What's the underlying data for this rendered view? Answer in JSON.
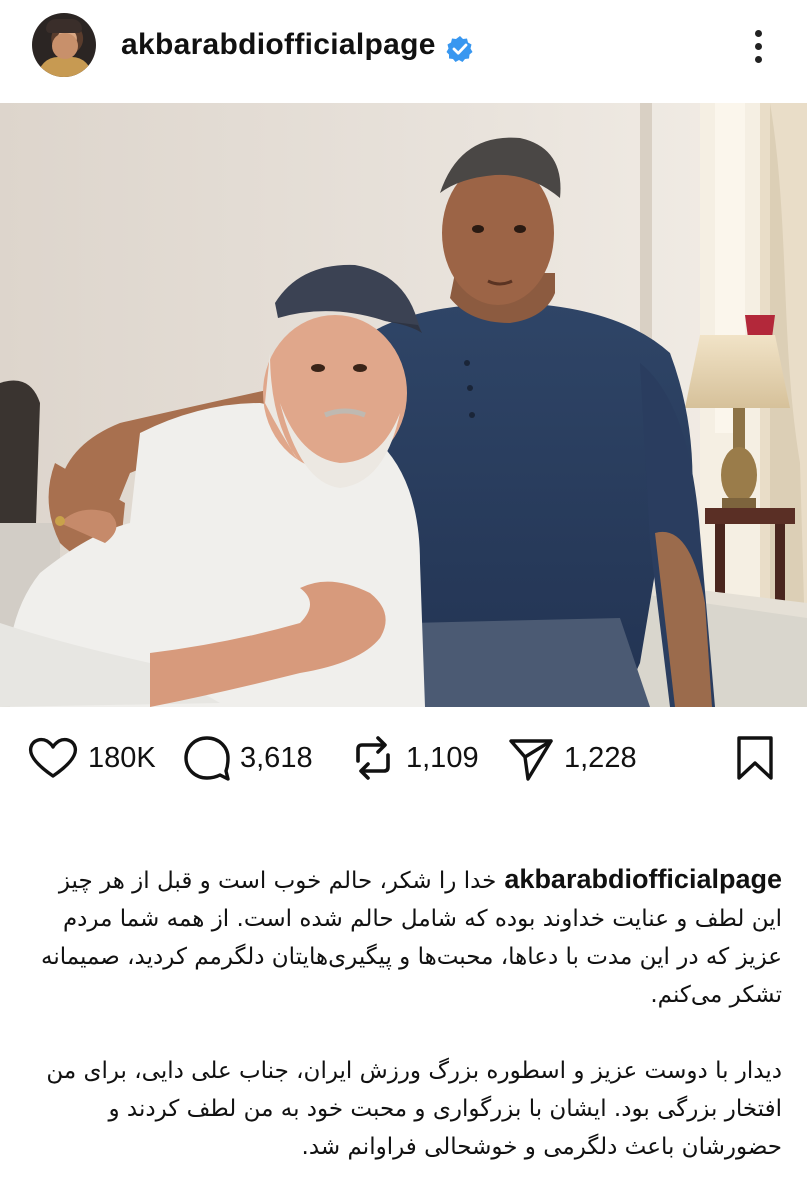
{
  "header": {
    "username": "akbarabdiofficialpage",
    "verified_icon": "verified-badge-icon",
    "more_icon": "more-vertical-icon",
    "accent": "#3897f0"
  },
  "post": {
    "photo_alt": "photo",
    "actions": {
      "likes": "180K",
      "comments": "3,618",
      "reposts": "1,109",
      "shares": "1,228",
      "like_icon": "heart-icon",
      "comment_icon": "comment-bubble-icon",
      "repost_icon": "repost-icon",
      "share_icon": "send-icon",
      "save_icon": "bookmark-icon"
    },
    "caption": {
      "username": "akbarabdiofficialpage",
      "para1": "خدا را شکر، حالم خوب است و قبل از هر چیز این لطف و عنایت خداوند بوده که شامل حالم شده است. از همه شما مردم عزیز که در این مدت با دعاها، محبت‌ها و پیگیری‌هایتان دلگرمم کردید، صمیمانه تشکر می‌کنم.",
      "para2": "دیدار با دوست عزیز و اسطوره بزرگ ورزش ایران، جناب علی دایی، برای من افتخار بزرگی بود. ایشان با بزرگواری و محبت خود به من لطف کردند و حضورشان باعث دلگرمی و خوشحالی فراوانم شد."
    }
  }
}
